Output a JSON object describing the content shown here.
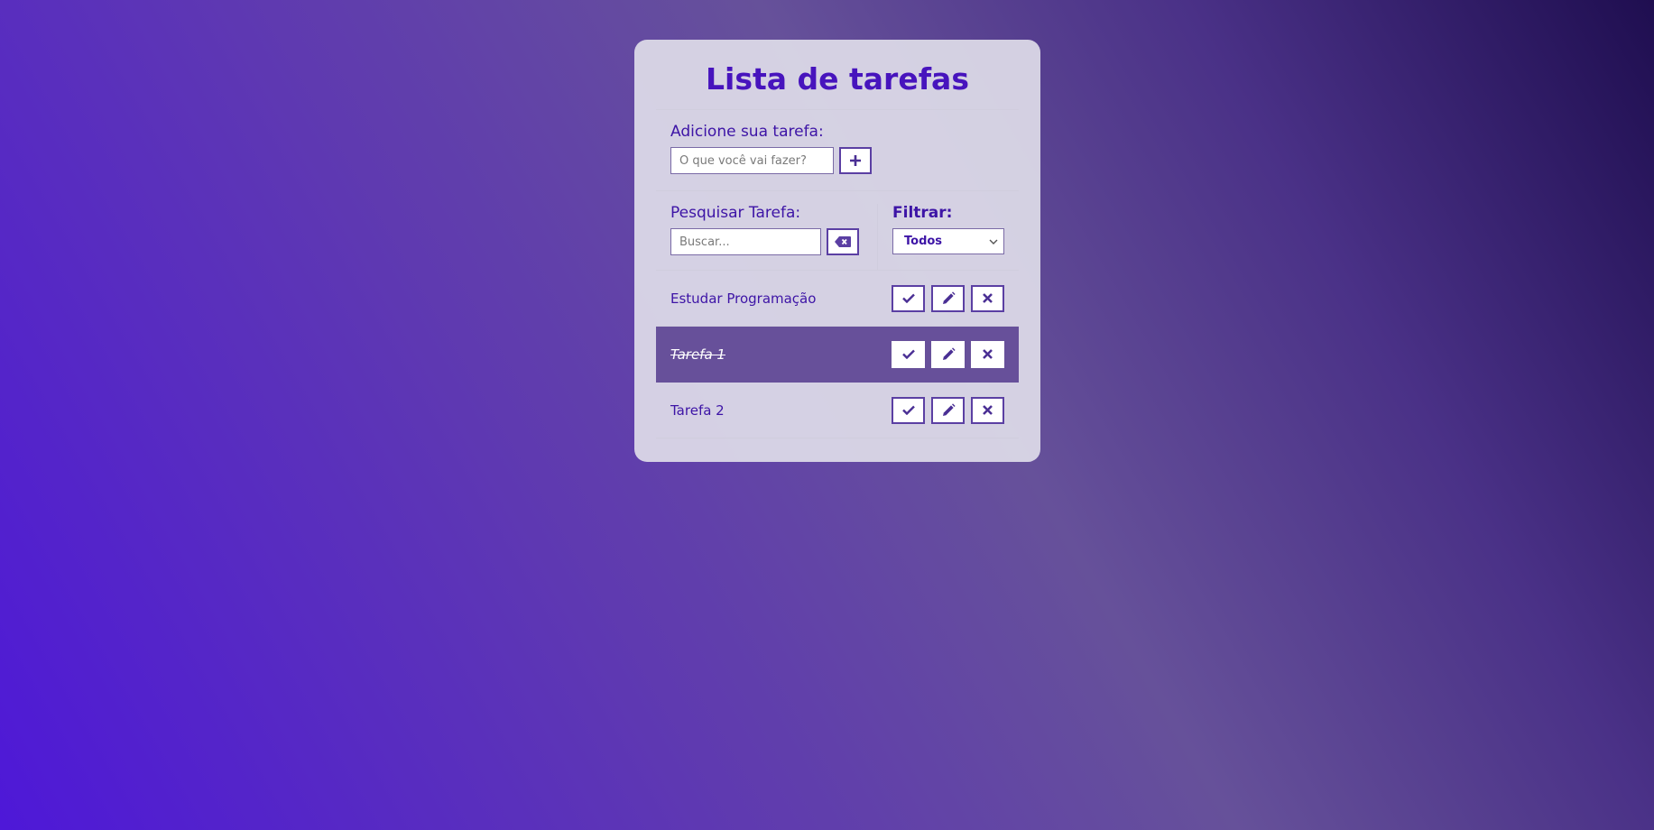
{
  "app": {
    "title": "Lista de tarefas"
  },
  "add": {
    "label": "Adicione sua tarefa:",
    "placeholder": "O que você vai fazer?",
    "button_icon": "plus-icon"
  },
  "search": {
    "label": "Pesquisar Tarefa:",
    "placeholder": "Buscar...",
    "clear_icon": "backspace-icon"
  },
  "filter": {
    "label": "Filtrar:",
    "selected": "Todos"
  },
  "tasks": [
    {
      "title": "Estudar Programação",
      "done": false
    },
    {
      "title": "Tarefa 1",
      "done": true
    },
    {
      "title": "Tarefa 2",
      "done": false
    }
  ],
  "task_actions": [
    "check-icon",
    "pencil-icon",
    "close-icon"
  ],
  "colors": {
    "accent": "#4714bd",
    "done_background": "#67509a",
    "button_border": "#5b3fa3"
  }
}
